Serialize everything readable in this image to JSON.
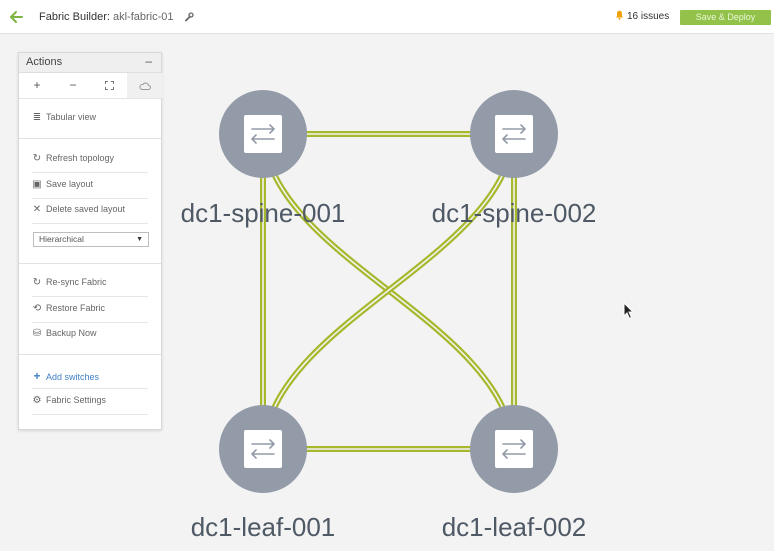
{
  "header": {
    "title_prefix": "Fabric Builder:",
    "fabric_name": "akl-fabric-01",
    "issues_label": "16 issues",
    "deploy_label": "Save & Deploy"
  },
  "colors": {
    "accent_green": "#92c24a",
    "link_color": "#a8b82c",
    "node_fill": "#939ba8",
    "label_color": "#4e5965"
  },
  "actions": {
    "title": "Actions",
    "tools": [
      "+",
      "−"
    ],
    "items": {
      "tabular_view": "Tabular view",
      "refresh": "Refresh topology",
      "save_layout": "Save layout",
      "delete_layout": "Delete saved layout",
      "layout_select": "Hierarchical",
      "resync": "Re-sync Fabric",
      "restore": "Restore Fabric",
      "backup": "Backup Now",
      "add_switches": "Add switches",
      "fabric_settings": "Fabric Settings"
    }
  },
  "topology": {
    "nodes": [
      {
        "name": "dc1-spine-001"
      },
      {
        "name": "dc1-spine-002"
      },
      {
        "name": "dc1-leaf-001"
      },
      {
        "name": "dc1-leaf-002"
      }
    ]
  }
}
